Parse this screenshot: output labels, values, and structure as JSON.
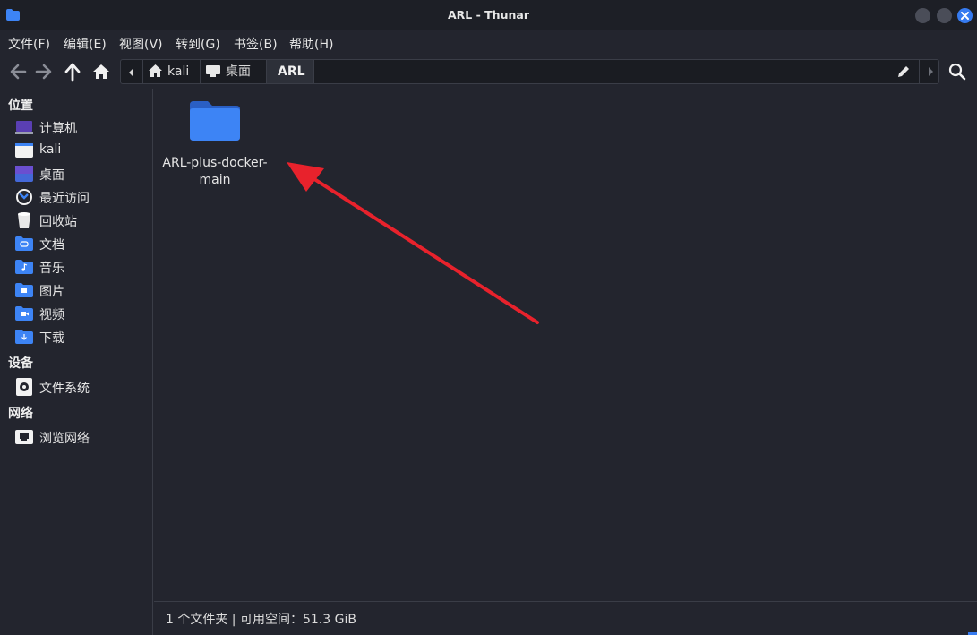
{
  "window": {
    "title": "ARL - Thunar",
    "accent": "#367bf0"
  },
  "menu": [
    "文件(F)",
    "编辑(E)",
    "视图(V)",
    "转到(G)",
    "书签(B)",
    "帮助(H)"
  ],
  "toolbar": {
    "icons": [
      "back-arrow-icon",
      "forward-arrow-icon",
      "up-arrow-icon",
      "home-icon"
    ]
  },
  "pathbar": {
    "crumbs": [
      {
        "label": "kali",
        "icon": "home-icon"
      },
      {
        "label": "桌面",
        "icon": "desktop-icon"
      },
      {
        "label": "ARL",
        "icon": ""
      }
    ]
  },
  "sidebar": {
    "places_heading": "位置",
    "places": [
      {
        "label": "计算机",
        "icon": "computer-icon"
      },
      {
        "label": "kali",
        "icon": "home-folder-icon"
      },
      {
        "label": "桌面",
        "icon": "desktop-icon"
      },
      {
        "label": "最近访问",
        "icon": "recent-icon"
      },
      {
        "label": "回收站",
        "icon": "trash-icon"
      },
      {
        "label": "文档",
        "icon": "documents-folder-icon"
      },
      {
        "label": "音乐",
        "icon": "music-folder-icon"
      },
      {
        "label": "图片",
        "icon": "pictures-folder-icon"
      },
      {
        "label": "视频",
        "icon": "videos-folder-icon"
      },
      {
        "label": "下载",
        "icon": "downloads-folder-icon"
      }
    ],
    "devices_heading": "设备",
    "devices": [
      {
        "label": "文件系统",
        "icon": "drive-icon"
      }
    ],
    "network_heading": "网络",
    "network": [
      {
        "label": "浏览网络",
        "icon": "network-icon"
      }
    ]
  },
  "content": {
    "items": [
      {
        "name_line1": "ARL-plus-docker-",
        "name_line2": "main",
        "type": "folder"
      }
    ]
  },
  "status": {
    "text": "1 个文件夹 | 可用空间：51.3 GiB"
  },
  "annotation": {
    "color": "#e8222c"
  }
}
